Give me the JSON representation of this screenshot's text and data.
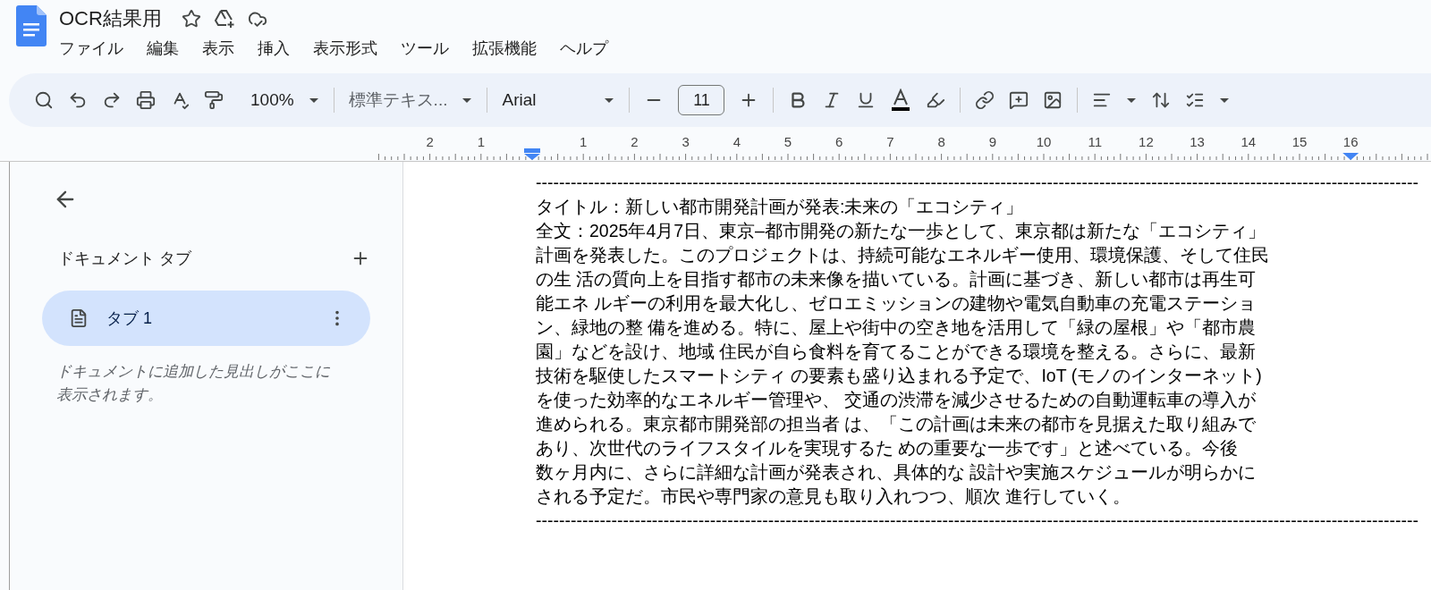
{
  "document": {
    "title": "OCR結果用"
  },
  "menu": [
    "ファイル",
    "編集",
    "表示",
    "挿入",
    "表示形式",
    "ツール",
    "拡張機能",
    "ヘルプ"
  ],
  "toolbar": {
    "zoom": "100%",
    "style": "標準テキス...",
    "font": "Arial",
    "font_size": "11"
  },
  "ruler": {
    "labels": [
      "2",
      "1",
      "1",
      "2",
      "3",
      "4",
      "5",
      "6",
      "7",
      "8",
      "9",
      "10",
      "11",
      "12",
      "13",
      "14",
      "15",
      "16"
    ]
  },
  "sidebar": {
    "heading": "ドキュメント タブ",
    "tabs": [
      {
        "label": "タブ 1",
        "selected": true
      }
    ],
    "hint": "ドキュメントに追加した見出しがここに表示されます。"
  },
  "body": {
    "lines": [
      "--------------------------------------------------------------------------------------------------------------------------------------------------------",
      "タイトル：新しい都市開発計画が発表:未来の「エコシティ」",
      "全文：2025年4月7日、東京–都市開発の新たな一歩として、東京都は新たな「エコシティ」",
      "計画を発表した。このプロジェクトは、持続可能なエネルギー使用、環境保護、そして住民",
      "の生 活の質向上を目指す都市の未来像を描いている。計画に基づき、新しい都市は再生可",
      "能エネ ルギーの利用を最大化し、ゼロエミッションの建物や電気自動車の充電ステーショ",
      "ン、緑地の整 備を進める。特に、屋上や街中の空き地を活用して「緑の屋根」や「都市農",
      "園」などを設け、地域 住民が自ら食料を育てることができる環境を整える。さらに、最新",
      "技術を駆使したスマートシティ の要素も盛り込まれる予定で、IoT (モノのインターネット)",
      "を使った効率的なエネルギー管理や、 交通の渋滞を減少させるための自動運転車の導入が",
      "進められる。東京都市開発部の担当者 は、「この計画は未来の都市を見据えた取り組みで",
      "あり、次世代のライフスタイルを実現するた めの重要な一歩です」と述べている。今後",
      "数ヶ月内に、さらに詳細な計画が発表され、具体的な 設計や実施スケジュールが明らかに",
      "される予定だ。市民や専門家の意見も取り入れつつ、順次 進行していく。",
      "--------------------------------------------------------------------------------------------------------------------------------------------------------"
    ]
  }
}
